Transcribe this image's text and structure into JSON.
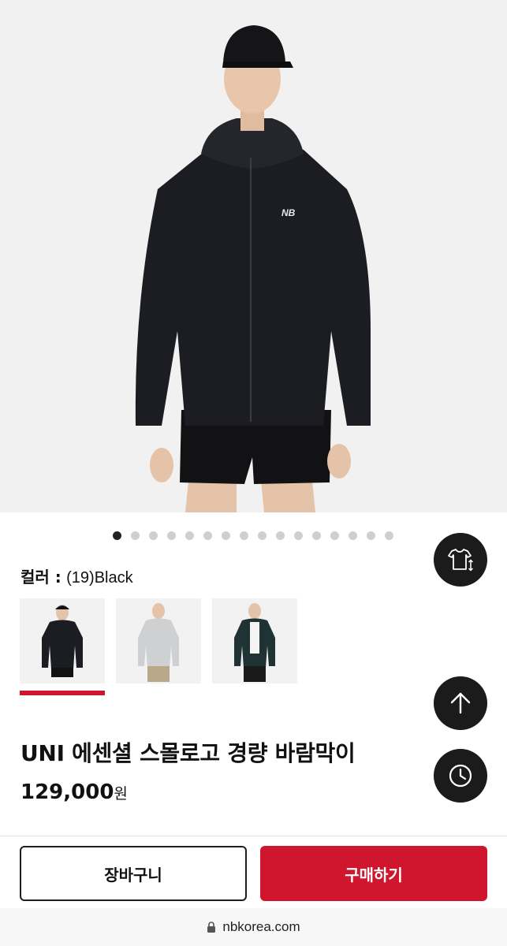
{
  "gallery": {
    "slide_count": 16,
    "active_index": 0
  },
  "color": {
    "label": "컬러 :",
    "value": "(19)Black",
    "options": [
      {
        "name": "black",
        "jacket_color": "#1c1d22",
        "selected": true
      },
      {
        "name": "grey",
        "jacket_color": "#cfd0d2",
        "selected": false
      },
      {
        "name": "dark-green",
        "jacket_color": "#1f3335",
        "selected": false
      }
    ]
  },
  "product": {
    "name": "UNI 에센셜 스몰로고 경량 바람막이",
    "price": "129,000",
    "price_unit": "원"
  },
  "actions": {
    "cart_label": "장바구니",
    "buy_label": "구매하기"
  },
  "browser": {
    "url": "nbkorea.com"
  },
  "icons": {
    "size_compare": "shirt-size-icon",
    "scroll_top": "arrow-up-icon",
    "recent": "clock-icon",
    "lock": "lock-icon"
  },
  "colors": {
    "accent": "#d0162e",
    "fab": "#1b1b1b",
    "jacket": "#1c1d22"
  }
}
